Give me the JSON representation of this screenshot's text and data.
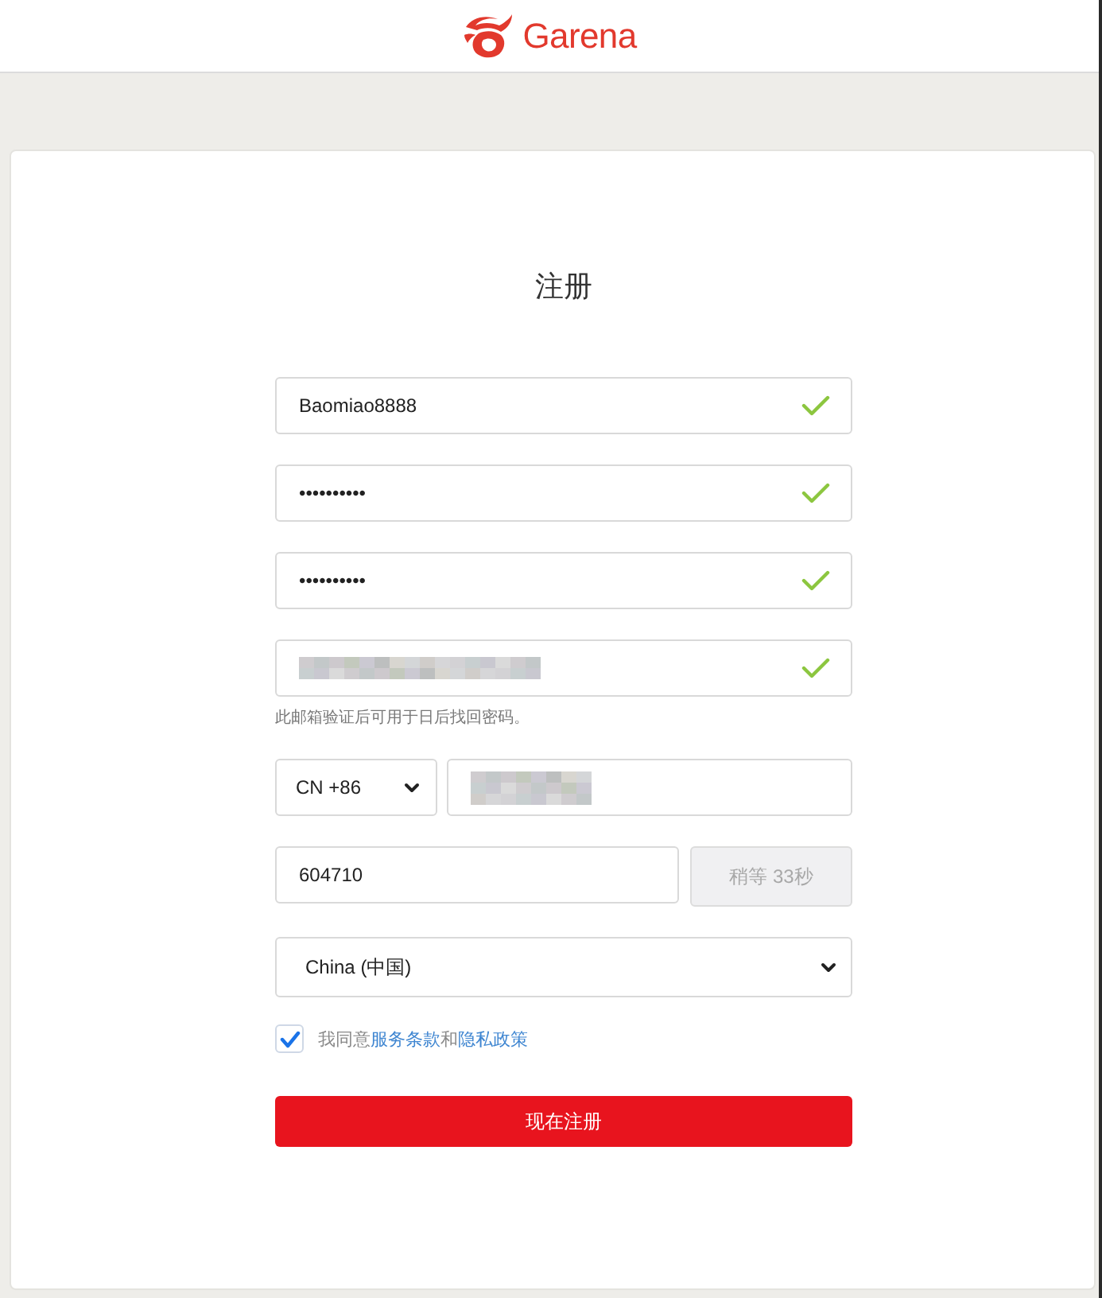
{
  "header": {
    "logo_text": "Garena"
  },
  "form": {
    "title": "注册",
    "fields": [
      {
        "kind": "plain",
        "value": "Baomiao8888",
        "valid": true
      },
      {
        "kind": "plain",
        "value": "••••••••••",
        "valid": true
      },
      {
        "kind": "plain",
        "value": "••••••••••",
        "valid": true
      },
      {
        "kind": "redacted",
        "valid": true,
        "hint": "此邮箱验证后可用于日后找回密码。"
      }
    ],
    "phone": {
      "country_code": "CN +86",
      "redacted": true
    },
    "verification": {
      "value": "604710",
      "resend_button": {
        "label": "稍等 33秒",
        "disabled": true
      }
    },
    "country": {
      "value": "China (中国)"
    },
    "agreement": {
      "checked": true,
      "parts": [
        {
          "kind": "text",
          "text": "我同意"
        },
        {
          "kind": "link",
          "text": "服务条款"
        },
        {
          "kind": "text",
          "text": "和"
        },
        {
          "kind": "link",
          "text": "隐私政策"
        }
      ]
    },
    "submit_button": {
      "label": "现在注册"
    }
  }
}
